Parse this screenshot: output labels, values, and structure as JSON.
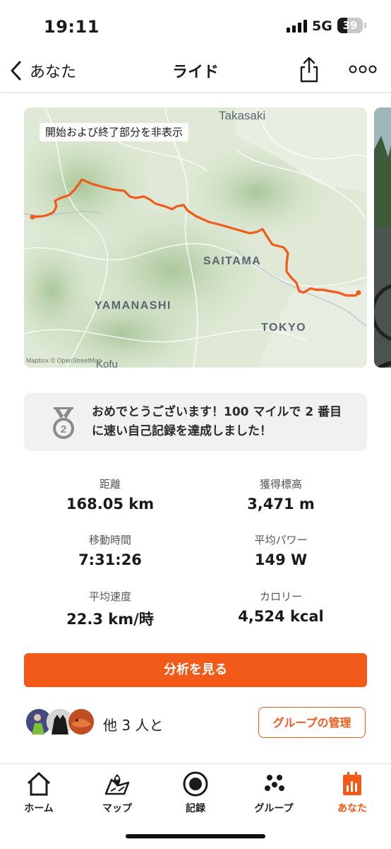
{
  "status_bar": {
    "time": "19:11",
    "network": "5G",
    "battery": "39"
  },
  "header": {
    "back_label": "あなた",
    "title": "ライド"
  },
  "map": {
    "toggle_label": "開始および終了部分を非表示",
    "places": {
      "takasaki": "Takasaki",
      "saitama": "SAITAMA",
      "yamanashi": "YAMANASHI",
      "tokyo": "TOKYO",
      "kofu": "Kofu"
    },
    "attribution": "Mapbox © OpenStreetMap",
    "route_color": "#f25a1a"
  },
  "achievement": {
    "text": "おめでとうございます！100 マイルで 2 番目に速い自己記録を達成しました！",
    "medal_number": "2"
  },
  "stats": [
    {
      "label": "距離",
      "value": "168.05 km"
    },
    {
      "label": "獲得標高",
      "value": "3,471 m"
    },
    {
      "label": "移動時間",
      "value": "7:31:26"
    },
    {
      "label": "平均パワー",
      "value": "149 W"
    },
    {
      "label": "平均速度",
      "value": "22.3 km/時"
    },
    {
      "label": "カロリー",
      "value": "4,524 kcal"
    }
  ],
  "analyze_button": "分析を見る",
  "group": {
    "text": "他 3 人と",
    "manage_button": "グループの管理"
  },
  "tabs": [
    {
      "label": "ホーム",
      "icon": "home-icon"
    },
    {
      "label": "マップ",
      "icon": "map-icon"
    },
    {
      "label": "記録",
      "icon": "record-icon"
    },
    {
      "label": "グループ",
      "icon": "groups-icon"
    },
    {
      "label": "あなた",
      "icon": "you-icon",
      "active": true
    }
  ],
  "accent_color": "#f25a1a"
}
